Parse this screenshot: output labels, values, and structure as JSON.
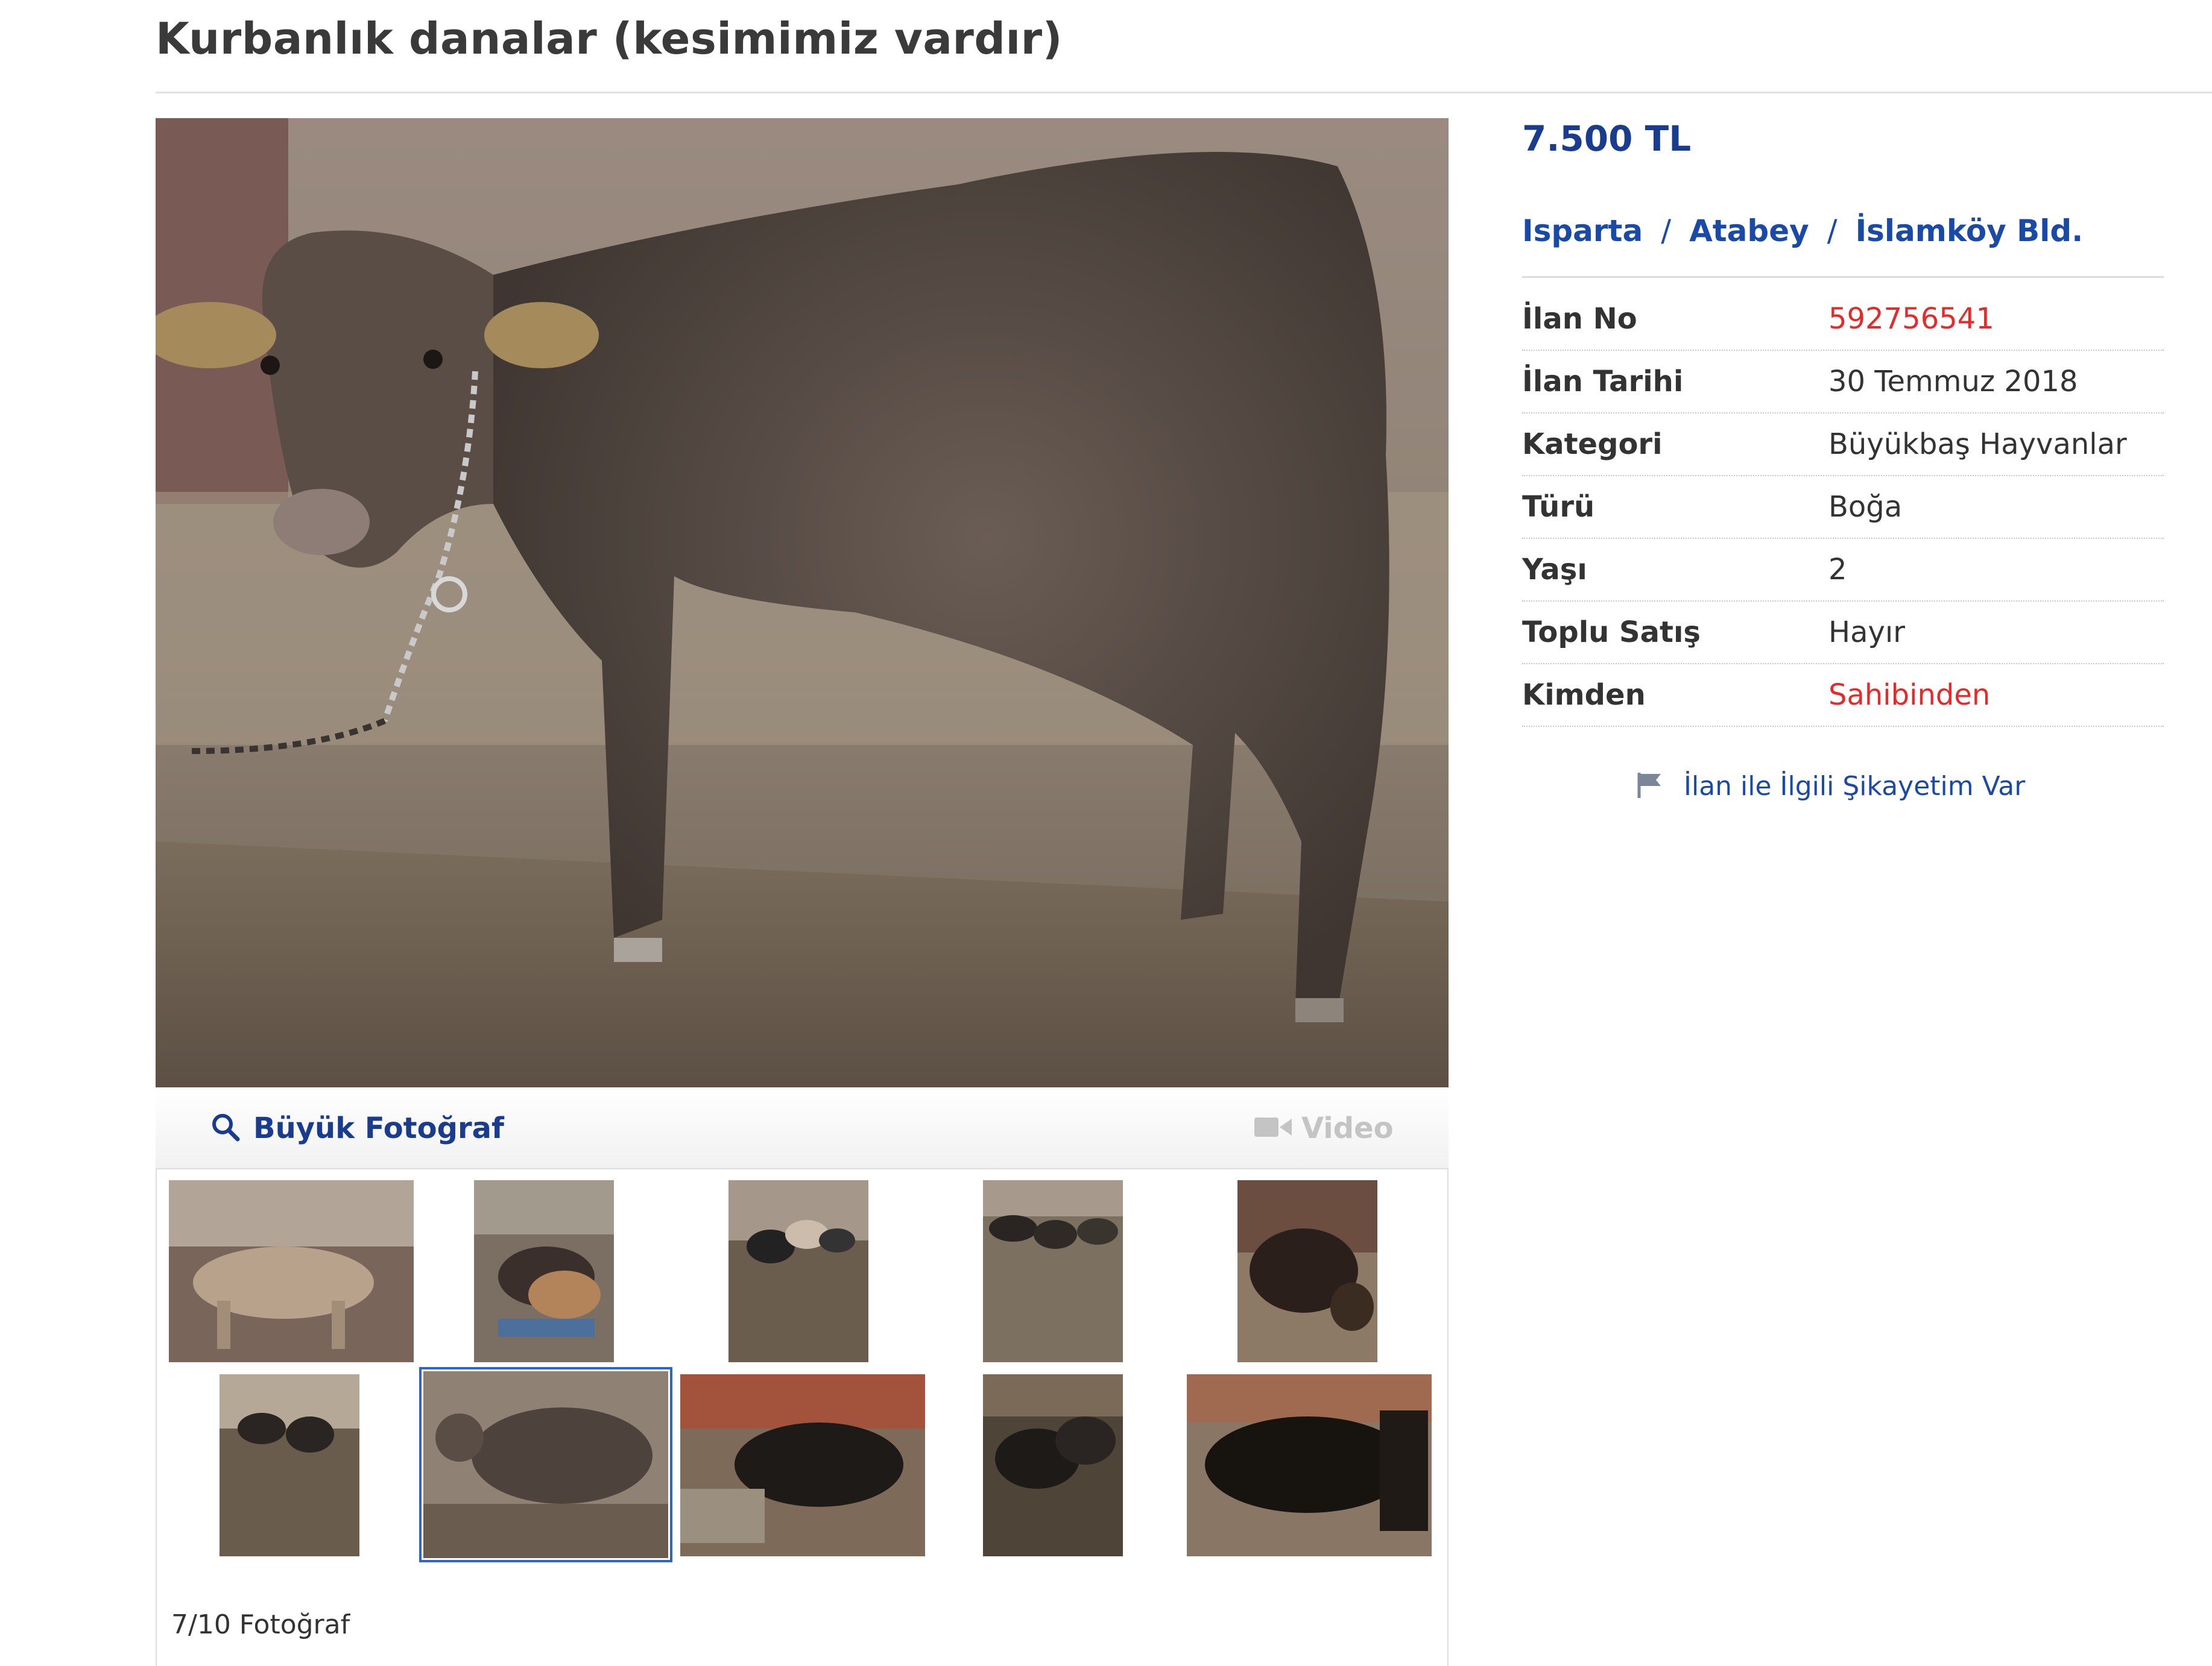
{
  "listing": {
    "title": "Kurbanlık danalar (kesimimiz vardır)",
    "price": "7.500 TL"
  },
  "location": {
    "city": "Isparta",
    "district": "Atabey",
    "neighborhood": "İslamköy Bld.",
    "separator": "/"
  },
  "details": [
    {
      "label": "İlan No",
      "value": "592756541",
      "highlight": true
    },
    {
      "label": "İlan Tarihi",
      "value": "30 Temmuz 2018",
      "highlight": false
    },
    {
      "label": "Kategori",
      "value": "Büyükbaş Hayvanlar",
      "highlight": false
    },
    {
      "label": "Türü",
      "value": "Boğa",
      "highlight": false
    },
    {
      "label": "Yaşı",
      "value": "2",
      "highlight": false
    },
    {
      "label": "Toplu Satış",
      "value": "Hayır",
      "highlight": false
    },
    {
      "label": "Kimden",
      "value": "Sahibinden",
      "highlight": true
    }
  ],
  "complaint": {
    "label": "İlan ile İlgili Şikayetim Var",
    "icon": "flag-icon"
  },
  "gallery": {
    "big_photo_label": "Büyük Fotoğraf",
    "big_photo_icon": "search-icon",
    "video_label": "Video",
    "video_icon": "video-camera-icon",
    "counter": "7/10 Fotoğraf",
    "selected_index": 7,
    "total": 10
  },
  "colors": {
    "link_blue": "#1a3c8e",
    "highlight_red": "#e52a2a",
    "selected_border": "#2b66c8"
  }
}
